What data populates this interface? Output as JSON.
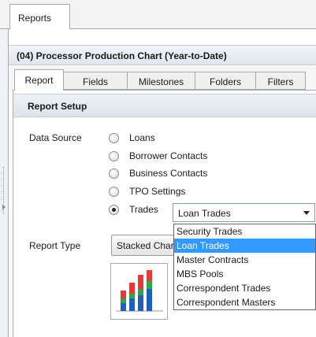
{
  "outer_tab": {
    "label": "Reports"
  },
  "report_title": "(04) Processor Production Chart (Year-to-Date)",
  "sub_tabs": [
    {
      "label": "Report",
      "active": true
    },
    {
      "label": "Fields",
      "active": false
    },
    {
      "label": "Milestones",
      "active": false
    },
    {
      "label": "Folders",
      "active": false
    },
    {
      "label": "Filters",
      "active": false
    }
  ],
  "setup_header": "Report Setup",
  "data_source": {
    "label": "Data Source",
    "options": [
      {
        "label": "Loans",
        "checked": false
      },
      {
        "label": "Borrower Contacts",
        "checked": false
      },
      {
        "label": "Business Contacts",
        "checked": false
      },
      {
        "label": "TPO Settings",
        "checked": false
      },
      {
        "label": "Trades",
        "checked": true
      }
    ]
  },
  "trades_combo": {
    "value": "Loan Trades",
    "options": [
      {
        "label": "Security Trades",
        "selected": false
      },
      {
        "label": "Loan Trades",
        "selected": true
      },
      {
        "label": "Master Contracts",
        "selected": false
      },
      {
        "label": "MBS Pools",
        "selected": false
      },
      {
        "label": "Correspondent Trades",
        "selected": false
      },
      {
        "label": "Correspondent Masters",
        "selected": false
      }
    ]
  },
  "report_type": {
    "label": "Report Type",
    "value": "Stacked Chart"
  },
  "chart_icon": {
    "name": "stacked-bar-chart-icon",
    "colors": [
      "#1f5fbf",
      "#2aa84a",
      "#e53935"
    ]
  }
}
